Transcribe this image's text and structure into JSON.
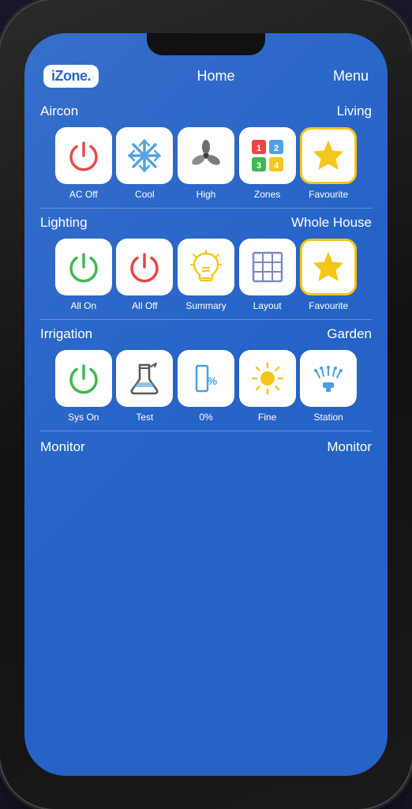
{
  "header": {
    "logo": "iZone.",
    "title": "Home",
    "menu": "Menu"
  },
  "sections": [
    {
      "label": "Aircon",
      "value": "Living",
      "icons": [
        {
          "id": "ac-off",
          "label": "AC Off",
          "type": "power-red"
        },
        {
          "id": "cool",
          "label": "Cool",
          "type": "snowflake"
        },
        {
          "id": "high",
          "label": "High",
          "type": "fan"
        },
        {
          "id": "zones",
          "label": "Zones",
          "type": "zones"
        },
        {
          "id": "favourite1",
          "label": "Favourite",
          "type": "star"
        }
      ]
    },
    {
      "label": "Lighting",
      "value": "Whole House",
      "icons": [
        {
          "id": "all-on",
          "label": "All On",
          "type": "power-green"
        },
        {
          "id": "all-off",
          "label": "All Off",
          "type": "power-red2"
        },
        {
          "id": "summary",
          "label": "Summary",
          "type": "bulb"
        },
        {
          "id": "layout",
          "label": "Layout",
          "type": "layout"
        },
        {
          "id": "favourite2",
          "label": "Favourite",
          "type": "star"
        }
      ]
    },
    {
      "label": "Irrigation",
      "value": "Garden",
      "icons": [
        {
          "id": "sys-on",
          "label": "Sys On",
          "type": "power-green2"
        },
        {
          "id": "test",
          "label": "Test",
          "type": "flask"
        },
        {
          "id": "percent",
          "label": "0%",
          "type": "bar-percent"
        },
        {
          "id": "fine",
          "label": "Fine",
          "type": "sun"
        },
        {
          "id": "station",
          "label": "Station",
          "type": "sprinkler"
        }
      ]
    }
  ],
  "bottom": {
    "left": "Monitor",
    "right": "Monitor"
  }
}
